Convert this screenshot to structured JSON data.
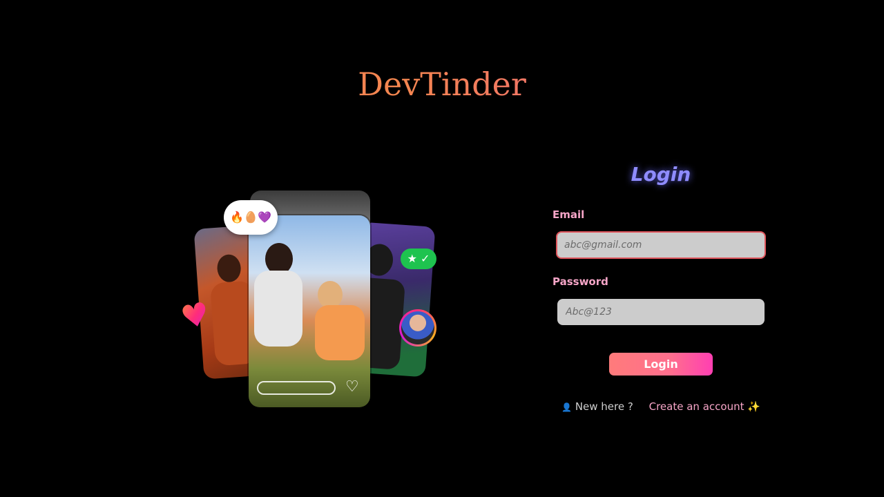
{
  "brand": {
    "name": "DevTinder"
  },
  "collage": {
    "emoji_bubble": "🔥🥚💜",
    "star_badge": "★ ✓",
    "heart": "♥",
    "like_icon": "♡"
  },
  "form": {
    "title": "Login",
    "email_label": "Email",
    "email_placeholder": "abc@gmail.com",
    "password_label": "Password",
    "password_placeholder": "Abc@123",
    "submit_label": "Login"
  },
  "signup": {
    "prompt_icon": "👤",
    "prompt": "New here ?",
    "link_text": "Create an account ✨"
  },
  "colors": {
    "background": "#000000",
    "accent_pink": "#ff3fb2",
    "accent_coral": "#f8736a",
    "title_glow": "#8f8cff"
  }
}
